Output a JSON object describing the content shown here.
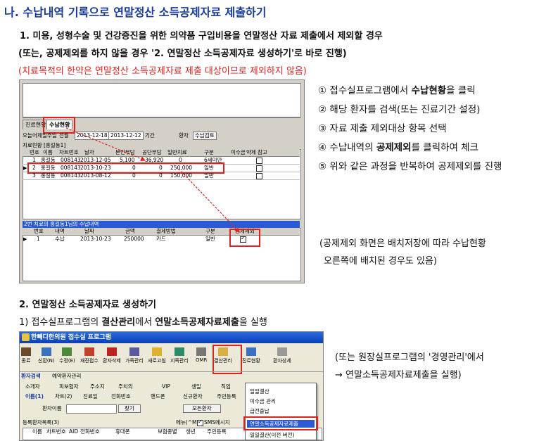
{
  "heading": "나. 수납내역 기록으로 연말정산 소득공제자료 제출하기",
  "section1": {
    "line1": "1. 미용, 성형수술 및 건강증진을 위한 의약품 구입비용을 연말정산 자료 제출에서 제외할 경우",
    "line2": "(또는, 공제제외를 하지 않을 경우 '2. 연말정산 소득공제자료 생성하기'로 바로 진행)",
    "line3": "(치료목적의 한약은 연말정산 소득공제자료 제출 대상이므로 제외하지 않음)"
  },
  "steps": [
    {
      "num": "①",
      "pre": "접수실프로그램에서 ",
      "bold": "수납현황",
      "post": "을 클릭"
    },
    {
      "num": "②",
      "pre": "해당 환자를 검색(또는 진료기간 설정)",
      "bold": "",
      "post": ""
    },
    {
      "num": "③",
      "pre": "자료 제출 제외대상 항목 선택",
      "bold": "",
      "post": ""
    },
    {
      "num": "④",
      "pre": "수납내역의 ",
      "bold": "공제제외",
      "post": "를 클릭하여 체크"
    },
    {
      "num": "⑤",
      "pre": "위와 같은 과정을 반복하여 공제제외를 진행",
      "bold": "",
      "post": ""
    }
  ],
  "note1": {
    "line1": "(공제제외 화면은 배치저장에 따라 수납현황",
    "line2": "오른쪽에 배치된 경우도 있음)"
  },
  "section2": {
    "title": "2. 연말정산 소득공제자료 생성하기",
    "line_pre": "1) 접수실프로그램의 ",
    "line_b1": "결산관리",
    "line_mid": "에서 ",
    "line_b2": "연말소득공제자료제출",
    "line_post": "을 실행"
  },
  "note2": {
    "line1": "(또는 원장실프로그램의 '경영관리'에서",
    "line2": "→ 연말소득공제자료제출을 실행)"
  },
  "shot1": {
    "tabs": [
      "진료현황",
      "수납현황"
    ],
    "filter": [
      "오늘",
      "어제",
      "일주일",
      "전월",
      "2013-12-18",
      "2013-12-12",
      "기간",
      "환자",
      "수납검토"
    ],
    "section_label": "치료현황 [홍길동1]",
    "headers": [
      "번호",
      "이름",
      "차트번호",
      "날자",
      "본인부담",
      "공단부담",
      "일반치료",
      "구분",
      "미수금",
      "약제",
      "참고"
    ],
    "rows": [
      [
        "1",
        "홍길동",
        "008143",
        "2013-12-05",
        "5,100",
        "36,920",
        "0",
        "6세미만"
      ],
      [
        "2",
        "홍길동",
        "008143",
        "2013-10-23",
        "0",
        "0",
        "250,000",
        "일반"
      ],
      [
        "3",
        "홍길동",
        "008143",
        "2013-08-12",
        "0",
        "0",
        "150,000",
        "일반"
      ]
    ],
    "lower_label": "2번 치료의 홍길동1님의 수납내역",
    "lower_headers": [
      "번호",
      "내역",
      "날짜",
      "금액",
      "결제방법",
      "구분",
      "공제제외"
    ],
    "lower_row": [
      "1",
      "수납",
      "2013-10-23",
      "250000",
      "카드",
      "일반"
    ]
  },
  "shot2": {
    "window_title": "한빼디한의원 접수실 프로그램",
    "toolbar": [
      "종료",
      "신환(N)",
      "수정(E)",
      "재진접수",
      "환자삭제",
      "가족관리",
      "새로고침",
      "지족관리",
      "OMR",
      "결산관리",
      "진료현황",
      "환자상세"
    ],
    "tabs": [
      "환자검색",
      "예약환자관리"
    ],
    "search_tabs": [
      "소개자",
      "피보험자",
      "주소지",
      "주치의",
      "VIP",
      "생일",
      "직업"
    ],
    "search_tabs2": [
      "이름(1)",
      "차트(2)",
      "진료일",
      "전화번호",
      "핸드폰",
      "신규환자",
      "주민등록"
    ],
    "patient_label": "환자이름",
    "search_btn": "찾기",
    "all_btn": "모든환자",
    "list_label": "등록환자목록(3)",
    "list_headers": [
      "이름",
      "차트번호",
      "AID",
      "전화번호",
      "휴대폰",
      "보험종별",
      "생년",
      "주민등록"
    ],
    "sms_label": "SMS메시지",
    "menu_label": "메뉴(^M)",
    "menu_items": [
      "일일결산",
      "미수금 관리",
      "급전출납",
      "연말소득공제자료제출",
      "일일결산(이전 버전)"
    ]
  }
}
